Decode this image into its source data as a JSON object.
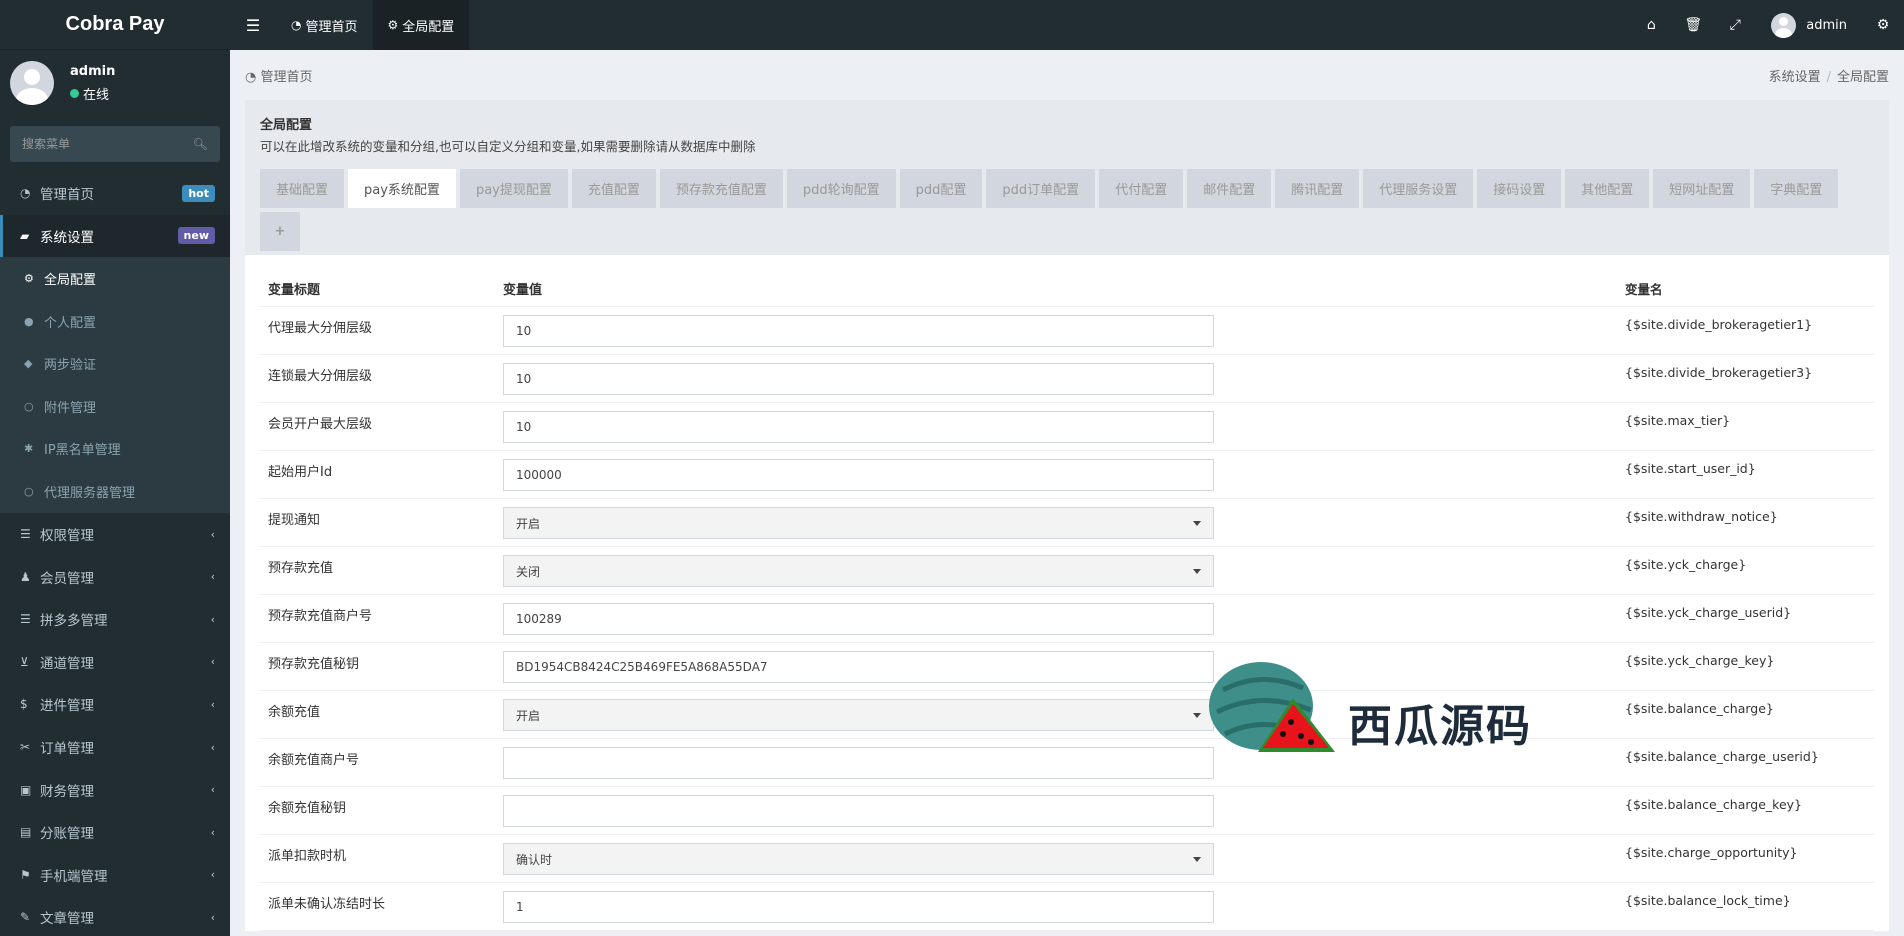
{
  "app": {
    "logo": "Cobra Pay"
  },
  "user": {
    "name": "admin",
    "status": "在线"
  },
  "search": {
    "placeholder": "搜索菜单"
  },
  "sidebar": {
    "items": [
      {
        "label": "管理首页",
        "icon": "dashboard-icon",
        "badge": "hot"
      },
      {
        "label": "系统设置",
        "icon": "folder-icon",
        "badge": "new"
      },
      {
        "label": "权限管理",
        "icon": "list-icon"
      },
      {
        "label": "会员管理",
        "icon": "user-add-icon"
      },
      {
        "label": "拼多多管理",
        "icon": "list-icon"
      },
      {
        "label": "通道管理",
        "icon": "cart-icon"
      },
      {
        "label": "进件管理",
        "icon": "dollar-icon"
      },
      {
        "label": "订单管理",
        "icon": "scissors-icon"
      },
      {
        "label": "财务管理",
        "icon": "money-icon"
      },
      {
        "label": "分账管理",
        "icon": "book-icon"
      },
      {
        "label": "手机端管理",
        "icon": "flag-icon"
      },
      {
        "label": "文章管理",
        "icon": "brush-icon"
      }
    ],
    "subitems": [
      {
        "label": "全局配置",
        "icon": "cogs-icon"
      },
      {
        "label": "个人配置",
        "icon": "user-icon"
      },
      {
        "label": "两步验证",
        "icon": "shield-icon"
      },
      {
        "label": "附件管理",
        "icon": "circle-icon"
      },
      {
        "label": "IP黑名单管理",
        "icon": "robot-icon"
      },
      {
        "label": "代理服务器管理",
        "icon": "circle-icon"
      }
    ]
  },
  "topbar": {
    "tabs": [
      {
        "label": "管理首页",
        "icon": "dashboard-icon"
      },
      {
        "label": "全局配置",
        "icon": "cogs-icon"
      }
    ],
    "user": "admin"
  },
  "breadcrumb": {
    "home": "管理首页",
    "path1": "系统设置",
    "path2": "全局配置"
  },
  "box": {
    "title": "全局配置",
    "desc": "可以在此增改系统的变量和分组,也可以自定义分组和变量,如果需要删除请从数据库中删除",
    "tabs": [
      "基础配置",
      "pay系统配置",
      "pay提现配置",
      "充值配置",
      "预存款充值配置",
      "pdd轮询配置",
      "pdd配置",
      "pdd订单配置",
      "代付配置",
      "邮件配置",
      "腾讯配置",
      "代理服务设置",
      "接码设置",
      "其他配置",
      "短网址配置",
      "字典配置"
    ],
    "active_tab": "pay系统配置",
    "add_tab": "+"
  },
  "table": {
    "headers": {
      "title": "变量标题",
      "value": "变量值",
      "name": "变量名"
    },
    "rows": [
      {
        "title": "代理最大分佣层级",
        "value": "10",
        "type": "input",
        "name": "{$site.divide_brokeragetier1}"
      },
      {
        "title": "连锁最大分佣层级",
        "value": "10",
        "type": "input",
        "name": "{$site.divide_brokeragetier3}"
      },
      {
        "title": "会员开户最大层级",
        "value": "10",
        "type": "input",
        "name": "{$site.max_tier}"
      },
      {
        "title": "起始用户Id",
        "value": "100000",
        "type": "input",
        "name": "{$site.start_user_id}"
      },
      {
        "title": "提现通知",
        "value": "开启",
        "type": "select",
        "name": "{$site.withdraw_notice}"
      },
      {
        "title": "预存款充值",
        "value": "关闭",
        "type": "select",
        "name": "{$site.yck_charge}"
      },
      {
        "title": "预存款充值商户号",
        "value": "100289",
        "type": "input",
        "name": "{$site.yck_charge_userid}"
      },
      {
        "title": "预存款充值秘钥",
        "value": "BD1954CB8424C25B469FE5A868A55DA7",
        "type": "input",
        "name": "{$site.yck_charge_key}"
      },
      {
        "title": "余额充值",
        "value": "开启",
        "type": "select",
        "name": "{$site.balance_charge}"
      },
      {
        "title": "余额充值商户号",
        "value": "",
        "type": "input",
        "name": "{$site.balance_charge_userid}"
      },
      {
        "title": "余额充值秘钥",
        "value": "",
        "type": "input",
        "name": "{$site.balance_charge_key}"
      },
      {
        "title": "派单扣款时机",
        "value": "确认时",
        "type": "select",
        "name": "{$site.charge_opportunity}"
      },
      {
        "title": "派单未确认冻结时长",
        "value": "1",
        "type": "input",
        "name": "{$site.balance_lock_time}"
      }
    ]
  },
  "watermark": {
    "text": "西瓜源码"
  }
}
